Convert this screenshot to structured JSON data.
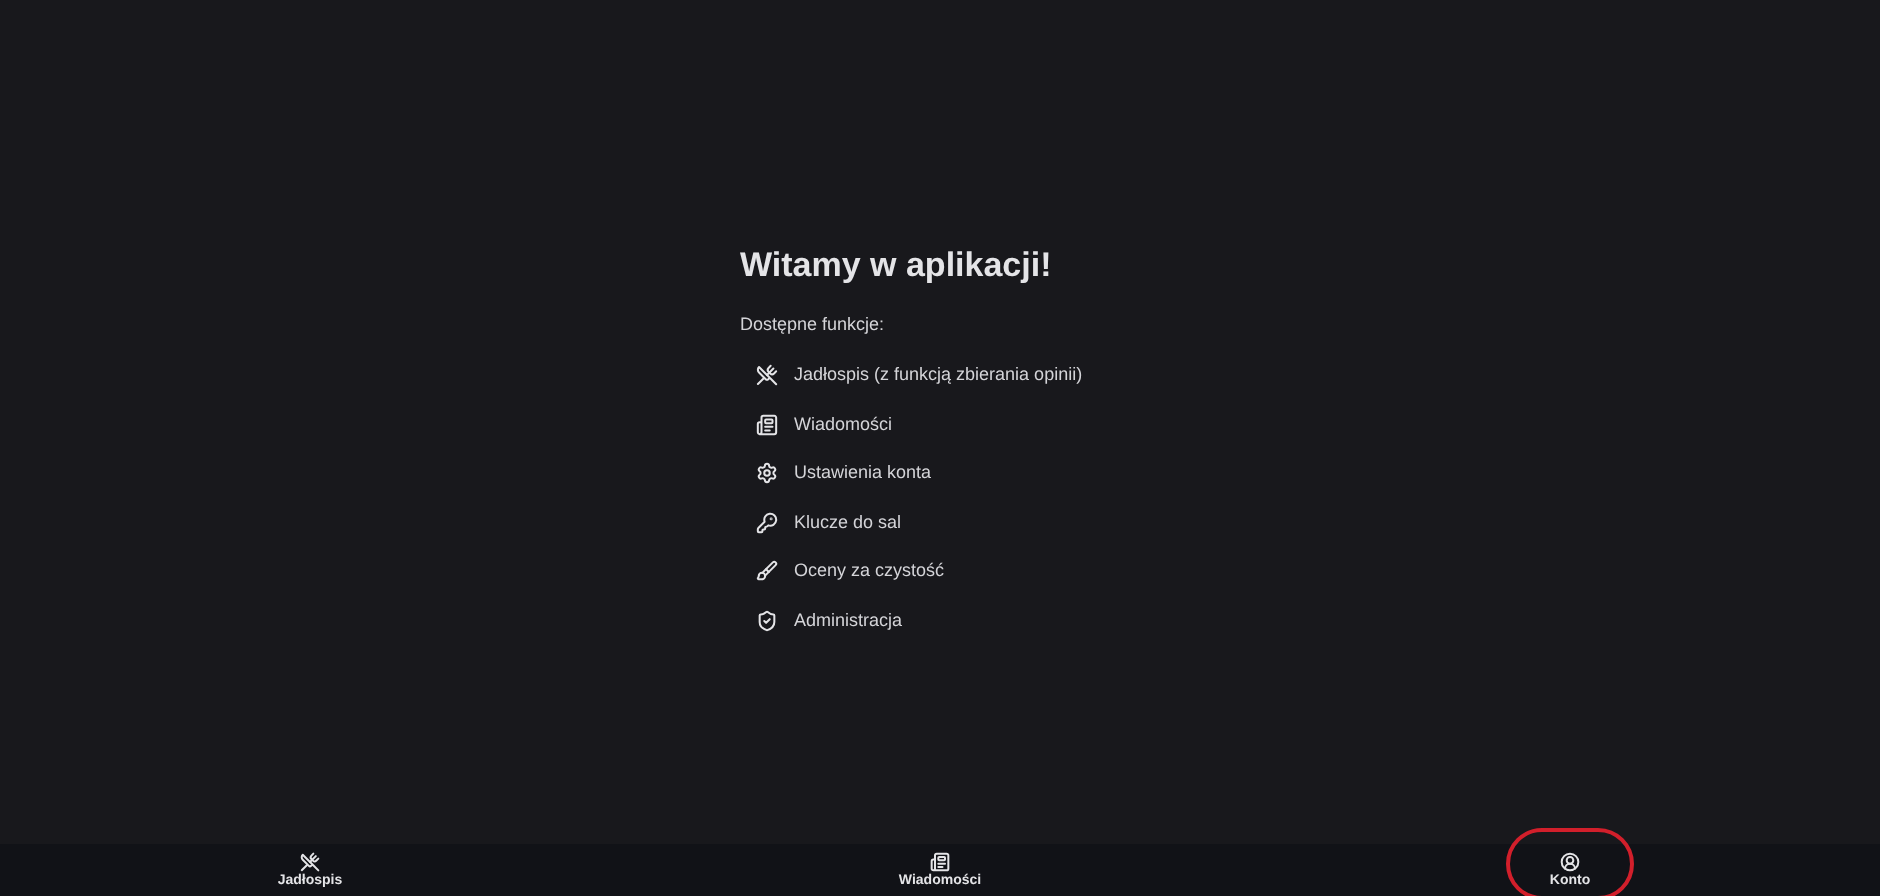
{
  "welcome": {
    "title": "Witamy w aplikacji!",
    "subtitle": "Dostępne funkcje:",
    "features": [
      {
        "label": "Jadłospis (z funkcją zbierania opinii)"
      },
      {
        "label": "Wiadomości"
      },
      {
        "label": "Ustawienia konta"
      },
      {
        "label": "Klucze do sal"
      },
      {
        "label": "Oceny za czystość"
      },
      {
        "label": "Administracja"
      }
    ]
  },
  "bottom_nav": [
    {
      "label": "Jadłospis",
      "highlighted": false
    },
    {
      "label": "Wiadomości",
      "highlighted": false
    },
    {
      "label": "Konto",
      "highlighted": true
    }
  ]
}
